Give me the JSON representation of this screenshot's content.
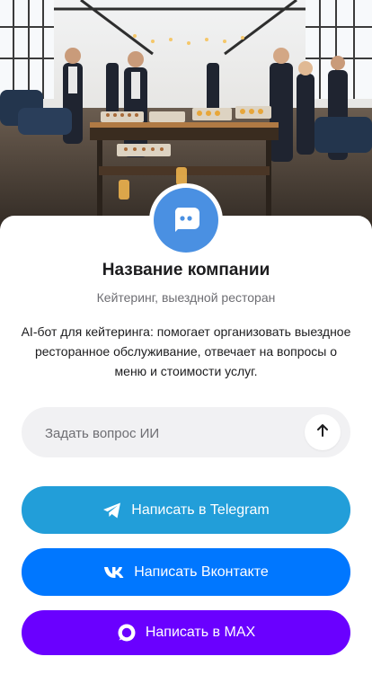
{
  "hero": {
    "image_description_icon": "catering-event-photo"
  },
  "company": {
    "avatar_icon": "chat-bot-icon",
    "name": "Название компании",
    "subtitle": "Кейтеринг, выездной ресторан",
    "description": "AI-бот для кейтеринга: помогает организовать выездное ресторанное обслуживание, отвечает на вопросы о меню и стоимости услуг."
  },
  "ask": {
    "placeholder": "Задать вопрос ИИ",
    "value": "",
    "send_icon": "arrow-up-icon"
  },
  "buttons": {
    "telegram": {
      "label": "Написать в Telegram",
      "icon": "telegram-icon",
      "color": "#229ed9"
    },
    "vk": {
      "label": "Написать Вконтакте",
      "icon": "vk-icon",
      "color": "#0077ff"
    },
    "max": {
      "label": "Написать в MAX",
      "icon": "max-icon",
      "color": "#6a00ff"
    }
  },
  "colors": {
    "avatar": "#4a90e2",
    "text_primary": "#1c1c1e",
    "text_secondary": "#6e6e73",
    "input_bg": "#f1f1f3"
  }
}
